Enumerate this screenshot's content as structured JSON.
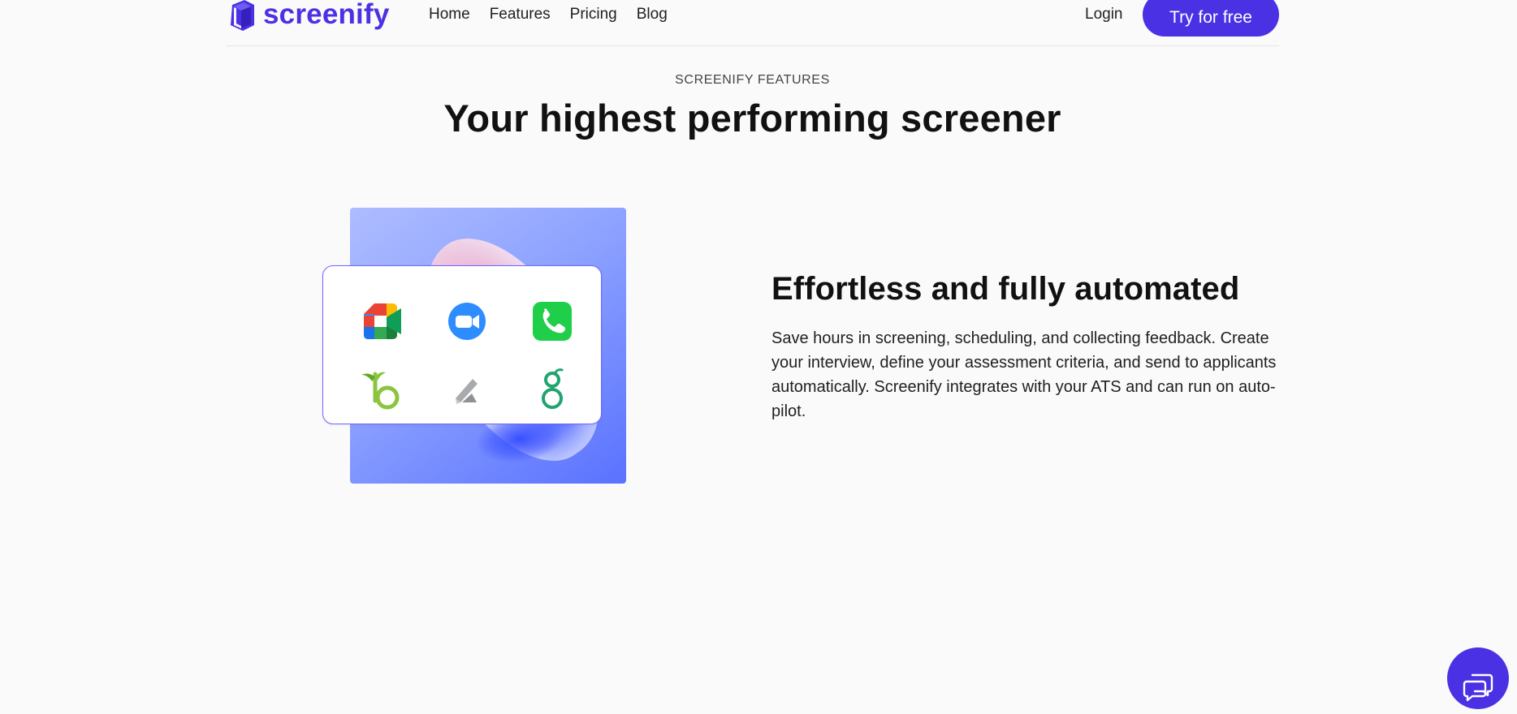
{
  "brand": {
    "name": "screenify",
    "logo_icon": "screenify-logo-icon",
    "accent": "#4b31e4"
  },
  "nav": {
    "items": [
      {
        "label": "Home"
      },
      {
        "label": "Features"
      },
      {
        "label": "Pricing"
      },
      {
        "label": "Blog"
      }
    ],
    "login_label": "Login",
    "cta_label": "Try for free"
  },
  "features": {
    "eyebrow": "SCREENIFY FEATURES",
    "title": "Your highest performing screener",
    "card": {
      "title": "Effortless and fully automated",
      "description": "Save hours in screening, scheduling, and collecting feedback. Create your interview, define your assessment criteria, and send to applicants automatically. Screenify integrates with your ATS and can run on auto-pilot."
    },
    "integration_icons": [
      "google-meet-icon",
      "zoom-icon",
      "phone-call-icon",
      "bamboohr-icon",
      "lever-icon",
      "greenhouse-icon"
    ]
  },
  "support_chat": {
    "icon": "chat-bubbles-icon"
  }
}
